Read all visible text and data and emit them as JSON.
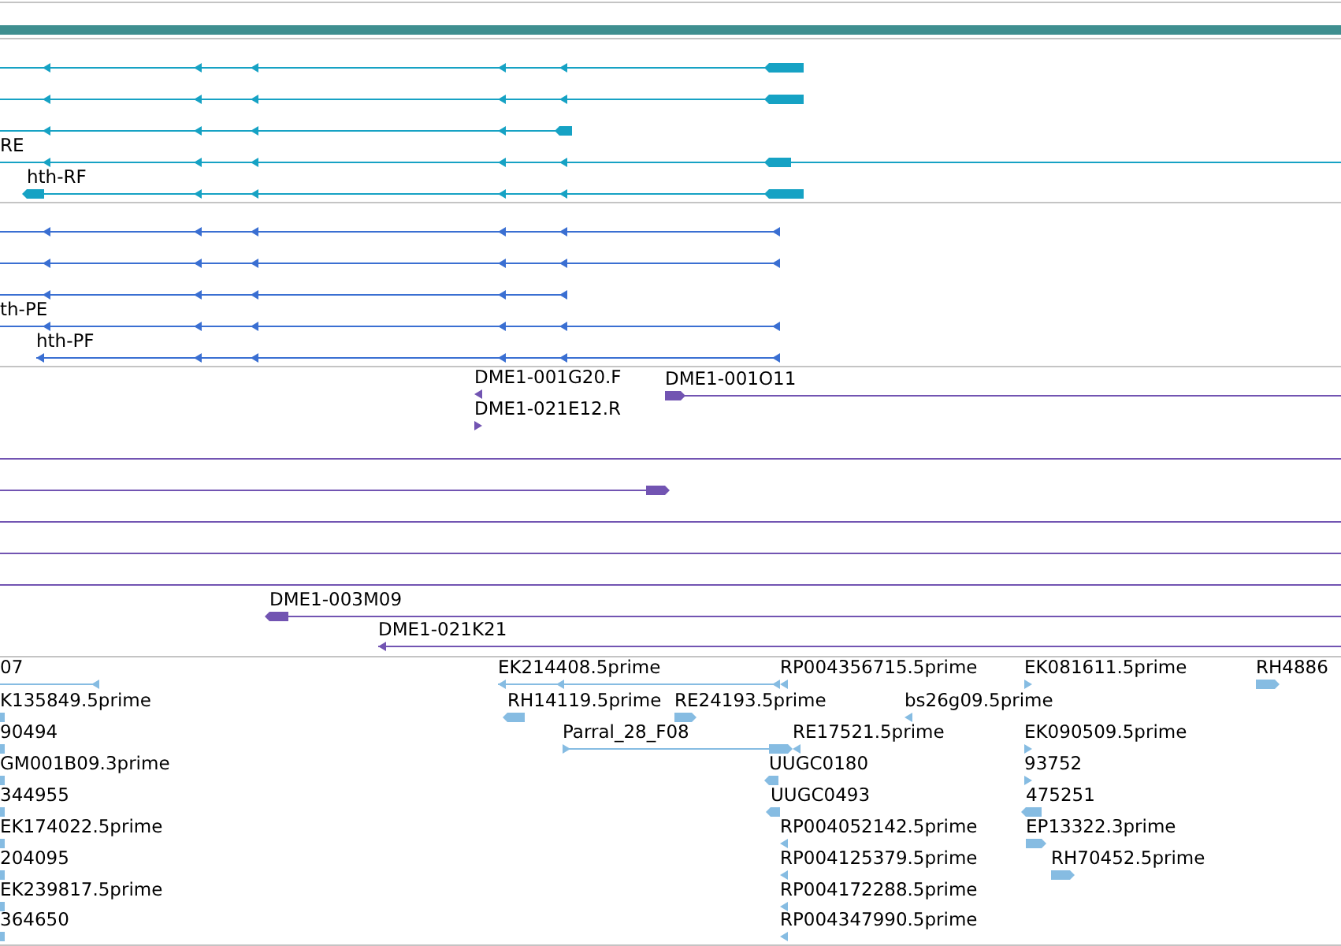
{
  "tracks": [
    {
      "color": "#16a2c4",
      "features": [
        {
          "kind": "arrow",
          "reverse": true
        },
        {
          "kind": "arrow",
          "reverse": true
        },
        {
          "kind": "arrow",
          "reverse": true
        },
        {
          "kind": "arrow",
          "label": "RE",
          "reverse": true
        },
        {
          "kind": "arrow",
          "label": "hth-RF",
          "reverse": true
        }
      ]
    },
    {
      "color": "#3a6fd2",
      "features": [
        {
          "kind": "arrow",
          "reverse": true
        },
        {
          "kind": "arrow",
          "reverse": true
        },
        {
          "kind": "arrow",
          "reverse": true
        },
        {
          "kind": "arrow",
          "label": "th-PE",
          "reverse": true
        },
        {
          "kind": "arrow",
          "label": "hth-PF",
          "reverse": true
        }
      ]
    },
    {
      "color": "#7254b2",
      "features": [
        {
          "kind": "arrow",
          "label": "DME1-001G20.F",
          "reverse": true
        },
        {
          "kind": "arrow",
          "label": "DME1-021E12.R",
          "reverse": false
        },
        {
          "kind": "arrow",
          "label": "DME1-001O11",
          "reverse": false
        },
        {
          "kind": "span"
        },
        {
          "kind": "arrow",
          "reverse": false
        },
        {
          "kind": "span"
        },
        {
          "kind": "span"
        },
        {
          "kind": "span"
        },
        {
          "kind": "arrow",
          "label": "DME1-003M09",
          "reverse": true
        },
        {
          "kind": "arrow",
          "label": "DME1-021K21",
          "reverse": true
        }
      ]
    },
    {
      "color": "#86bce2",
      "features": [
        {
          "kind": "arrow",
          "label": "07",
          "reverse": true
        },
        {
          "kind": "block",
          "label": "K135849.5prime"
        },
        {
          "kind": "block",
          "label": "90494"
        },
        {
          "kind": "block",
          "label": "GM001B09.3prime"
        },
        {
          "kind": "block",
          "label": "344955"
        },
        {
          "kind": "block",
          "label": "EK174022.5prime"
        },
        {
          "kind": "block",
          "label": "204095"
        },
        {
          "kind": "block",
          "label": "EK239817.5prime"
        },
        {
          "kind": "block",
          "label": "364650"
        },
        {
          "kind": "arrow",
          "label": "EK214408.5prime",
          "reverse": true
        },
        {
          "kind": "arrow",
          "label": "RH14119.5prime",
          "reverse": true
        },
        {
          "kind": "arrow",
          "label": "RE24193.5prime",
          "reverse": false
        },
        {
          "kind": "arrow",
          "label": "Parral_28_F08",
          "reverse": false
        },
        {
          "kind": "arrow",
          "label": "RP004356715.5prime",
          "reverse": true
        },
        {
          "kind": "arrow",
          "label": "RE17521.5prime",
          "reverse": true
        },
        {
          "kind": "arrow",
          "label": "UUGC0180",
          "reverse": true
        },
        {
          "kind": "arrow",
          "label": "UUGC0493",
          "reverse": true
        },
        {
          "kind": "arrow",
          "label": "RP004052142.5prime",
          "reverse": true
        },
        {
          "kind": "arrow",
          "label": "RP004125379.5prime",
          "reverse": true
        },
        {
          "kind": "arrow",
          "label": "RP004172288.5prime",
          "reverse": true
        },
        {
          "kind": "arrow",
          "label": "RP004347990.5prime",
          "reverse": true
        },
        {
          "kind": "arrow",
          "label": "bs26g09.5prime",
          "reverse": true
        },
        {
          "kind": "arrow",
          "label": "EK081611.5prime",
          "reverse": false
        },
        {
          "kind": "arrow",
          "label": "EK090509.5prime",
          "reverse": false
        },
        {
          "kind": "arrow",
          "label": "93752",
          "reverse": false
        },
        {
          "kind": "arrow",
          "label": "475251",
          "reverse": true
        },
        {
          "kind": "arrow",
          "label": "EP13322.3prime",
          "reverse": false
        },
        {
          "kind": "arrow",
          "label": "RH70452.5prime",
          "reverse": false
        },
        {
          "kind": "arrow",
          "label": "RH4886",
          "reverse": false
        }
      ]
    }
  ]
}
